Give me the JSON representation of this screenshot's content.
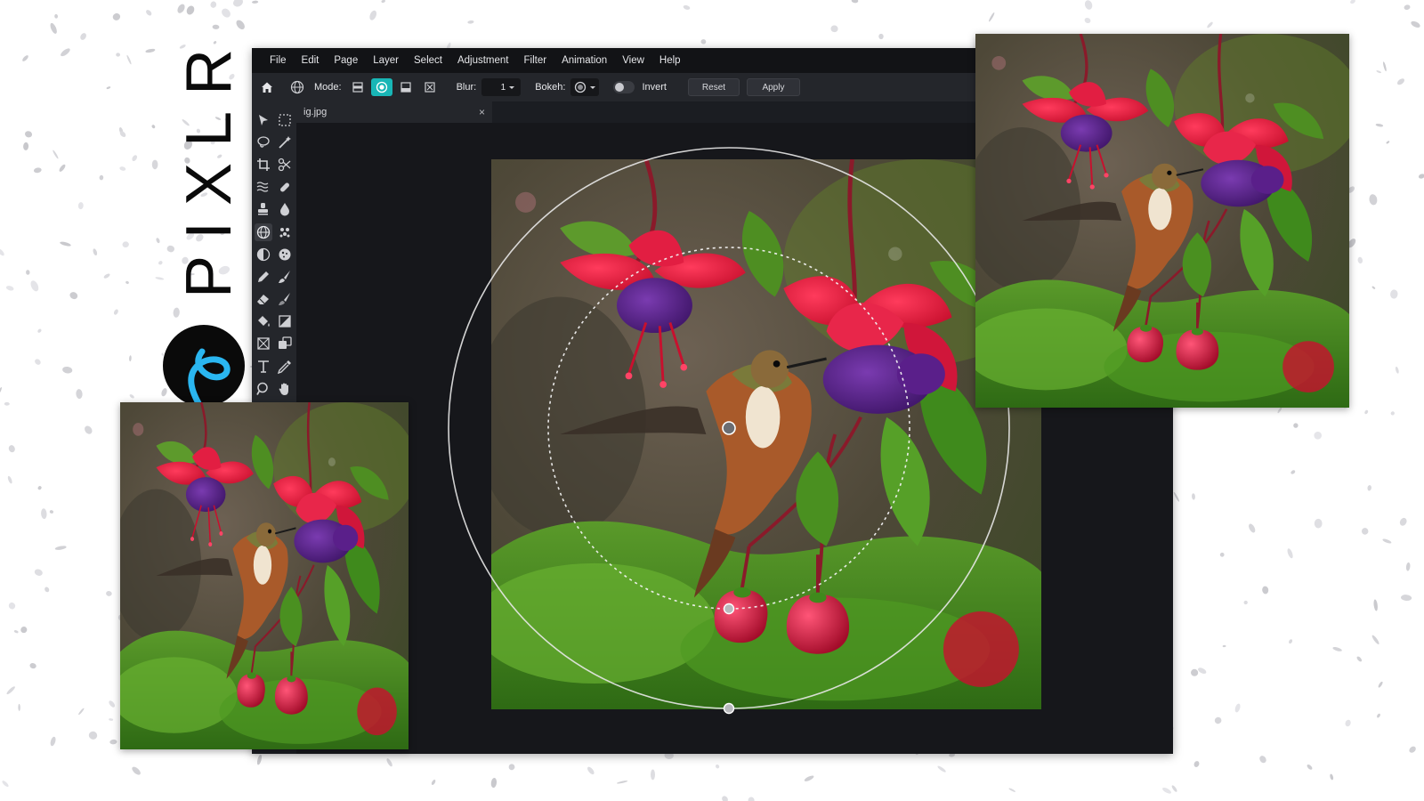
{
  "brand": {
    "wordmark": "PIXLR",
    "accent_color": "#2ab6f0"
  },
  "menubar": {
    "items": [
      "File",
      "Edit",
      "Page",
      "Layer",
      "Select",
      "Adjustment",
      "Filter",
      "Animation",
      "View",
      "Help"
    ]
  },
  "options_bar": {
    "home_icon": "home-icon",
    "tool_icon": "globe-icon",
    "mode_label": "Mode:",
    "mode_buttons": [
      "horizontal-mode-icon",
      "radial-mode-icon",
      "bottom-mode-icon",
      "box-mode-icon"
    ],
    "active_mode": "radial",
    "blur_label": "Blur:",
    "blur_value": "1",
    "bokeh_label": "Bokeh:",
    "invert_label": "Invert",
    "invert_on": false,
    "reset_label": "Reset",
    "apply_label": "Apply",
    "accent_color": "#18b6b6"
  },
  "document_tab": {
    "name": "ig.jpg",
    "close_glyph": "×"
  },
  "toolbox": {
    "rows": [
      [
        "arrange-tool-icon",
        "marquee-tool-icon"
      ],
      [
        "lasso-tool-icon",
        "wand-tool-icon"
      ],
      [
        "crop-tool-icon",
        "cutout-tool-icon"
      ],
      [
        "liquify-tool-icon",
        "heal-tool-icon"
      ],
      [
        "clone-stamp-tool-icon",
        "blur-drop-tool-icon"
      ],
      [
        "focus-tool-icon",
        "dots-tool-icon"
      ],
      [
        "dodge-tool-icon",
        "sponge-tool-icon"
      ],
      [
        "pencil-tool-icon",
        "brush-tool-icon"
      ],
      [
        "eraser-tool-icon",
        "color-replace-tool-icon"
      ],
      [
        "fill-tool-icon",
        "gradient-tool-icon"
      ],
      [
        "placeholder-tool-icon",
        "shape-tool-icon"
      ],
      [
        "text-tool-icon",
        "eyedropper-tool-icon"
      ],
      [
        "zoom-tool-icon",
        "hand-tool-icon"
      ]
    ],
    "active_tool": "focus-tool-icon"
  },
  "canvas": {
    "image_subject": "hummingbird-fuchsia-photo"
  }
}
